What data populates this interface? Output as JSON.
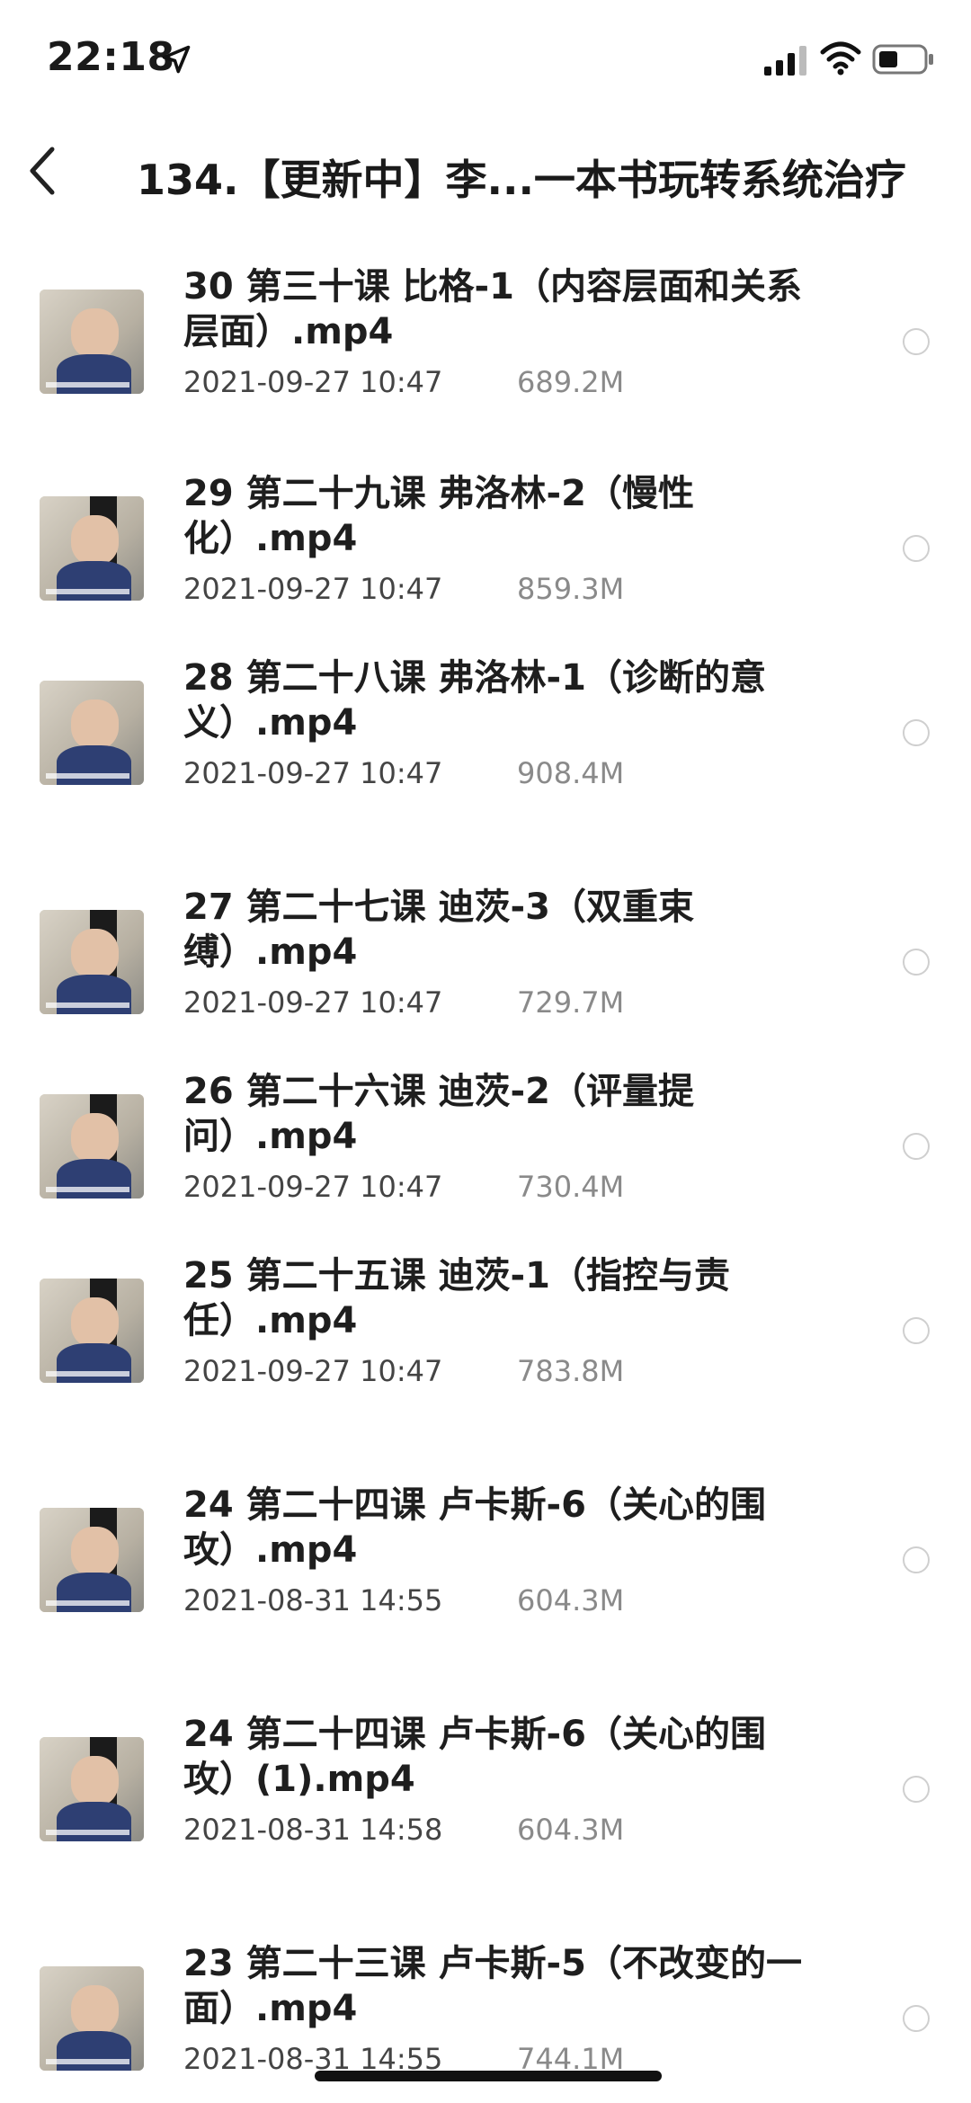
{
  "status_bar": {
    "time": "22:18"
  },
  "nav": {
    "title": "134.【更新中】李...一本书玩转系统治疗"
  },
  "files": [
    {
      "name": "30 第三十课 比格-1（内容层面和关系层面）.mp4",
      "date": "2021-09-27 10:47",
      "size": "689.2M",
      "thumb": "solo"
    },
    {
      "name": "29 第二十九课 弗洛林-2（慢性化）.mp4",
      "date": "2021-09-27 10:47",
      "size": "859.3M",
      "thumb": "grid"
    },
    {
      "name": "28 第二十八课 弗洛林-1（诊断的意义）.mp4",
      "date": "2021-09-27 10:47",
      "size": "908.4M",
      "thumb": "solo"
    },
    {
      "name": "27 第二十七课 迪茨-3（双重束缚）.mp4",
      "date": "2021-09-27 10:47",
      "size": "729.7M",
      "thumb": "grid"
    },
    {
      "name": "26 第二十六课 迪茨-2（评量提问）.mp4",
      "date": "2021-09-27 10:47",
      "size": "730.4M",
      "thumb": "grid"
    },
    {
      "name": "25 第二十五课 迪茨-1（指控与责任）.mp4",
      "date": "2021-09-27 10:47",
      "size": "783.8M",
      "thumb": "grid"
    },
    {
      "name": "24 第二十四课 卢卡斯-6（关心的围攻）.mp4",
      "date": "2021-08-31 14:55",
      "size": "604.3M",
      "thumb": "grid"
    },
    {
      "name": "24 第二十四课 卢卡斯-6（关心的围攻）(1).mp4",
      "date": "2021-08-31 14:58",
      "size": "604.3M",
      "thumb": "grid"
    },
    {
      "name": "23 第二十三课 卢卡斯-5（不改变的一面）.mp4",
      "date": "2021-08-31 14:55",
      "size": "744.1M",
      "thumb": "solo"
    }
  ]
}
